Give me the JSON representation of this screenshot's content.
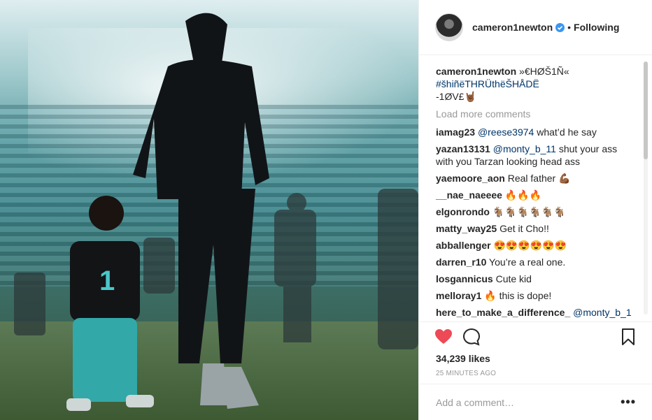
{
  "header": {
    "username": "cameron1newton",
    "separator": "•",
    "follow_status": "Following"
  },
  "caption": {
    "username": "cameron1newton",
    "line1": "»€HØŠ1Ñ«",
    "line2": "#šhiñëTHRÜthëŠHÅDË",
    "line3": "-1ØV£🤘🏾"
  },
  "load_more": "Load more comments",
  "comments": [
    {
      "user": "iamag23",
      "mention": "@reese3974",
      "text": " what’d he say"
    },
    {
      "user": "yazan13131",
      "mention": "@monty_b_11",
      "text": " shut your ass with you Tarzan looking head ass"
    },
    {
      "user": "yaemoore_aon",
      "mention": "",
      "text": "Real father 💪🏾"
    },
    {
      "user": "__nae_naeeee",
      "mention": "",
      "text": "🔥🔥🔥"
    },
    {
      "user": "elgonrondo",
      "mention": "",
      "text": "🐐🐐🐐🐐🐐🐐"
    },
    {
      "user": "matty_way25",
      "mention": "",
      "text": "Get it Cho!!"
    },
    {
      "user": "abballenger",
      "mention": "",
      "text": "😍😍😍😍😍😍"
    },
    {
      "user": "darren_r10",
      "mention": "",
      "text": "You’re a real one."
    },
    {
      "user": "losgannicus",
      "mention": "",
      "text": "Cute kid"
    },
    {
      "user": "melloray1",
      "mention": "",
      "text": "🔥 this is dope!"
    },
    {
      "user": "here_to_make_a_difference_",
      "mention": "@monty_b_1",
      "text": ""
    }
  ],
  "likes": "34,239 likes",
  "timestamp": "25 MINUTES AGO",
  "add_comment": {
    "placeholder": "Add a comment…",
    "more": "•••"
  },
  "colors": {
    "like_red": "#ed4956",
    "link_blue": "#003569",
    "verified_blue": "#3897f0"
  }
}
